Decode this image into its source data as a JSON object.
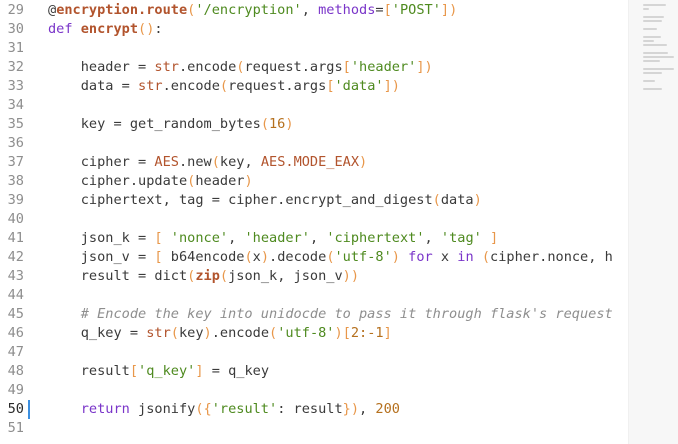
{
  "editor": {
    "current_line": "50",
    "lines": [
      {
        "num": "29",
        "tokens": [
          {
            "t": "dec-at",
            "v": "@"
          },
          {
            "t": "dec",
            "v": "encryption.route"
          },
          {
            "t": "paren",
            "v": "("
          },
          {
            "t": "str",
            "v": "'/encryption'"
          },
          {
            "t": "plain",
            "v": ", "
          },
          {
            "t": "kw",
            "v": "methods"
          },
          {
            "t": "op",
            "v": "="
          },
          {
            "t": "brack",
            "v": "["
          },
          {
            "t": "str",
            "v": "'POST'"
          },
          {
            "t": "brack",
            "v": "]"
          },
          {
            "t": "paren",
            "v": ")"
          }
        ]
      },
      {
        "num": "30",
        "tokens": [
          {
            "t": "kw",
            "v": "def "
          },
          {
            "t": "fn",
            "v": "encrypt"
          },
          {
            "t": "paren",
            "v": "()"
          },
          {
            "t": "plain",
            "v": ":"
          }
        ]
      },
      {
        "num": "31",
        "tokens": []
      },
      {
        "num": "32",
        "tokens": [
          {
            "t": "plain",
            "v": "    header "
          },
          {
            "t": "op",
            "v": "= "
          },
          {
            "t": "bi",
            "v": "str"
          },
          {
            "t": "plain",
            "v": ".encode"
          },
          {
            "t": "paren",
            "v": "("
          },
          {
            "t": "plain",
            "v": "request.args"
          },
          {
            "t": "brack",
            "v": "["
          },
          {
            "t": "str",
            "v": "'header'"
          },
          {
            "t": "brack",
            "v": "]"
          },
          {
            "t": "paren",
            "v": ")"
          }
        ]
      },
      {
        "num": "33",
        "tokens": [
          {
            "t": "plain",
            "v": "    data "
          },
          {
            "t": "op",
            "v": "= "
          },
          {
            "t": "bi",
            "v": "str"
          },
          {
            "t": "plain",
            "v": ".encode"
          },
          {
            "t": "paren",
            "v": "("
          },
          {
            "t": "plain",
            "v": "request.args"
          },
          {
            "t": "brack",
            "v": "["
          },
          {
            "t": "str",
            "v": "'data'"
          },
          {
            "t": "brack",
            "v": "]"
          },
          {
            "t": "paren",
            "v": ")"
          }
        ]
      },
      {
        "num": "34",
        "tokens": []
      },
      {
        "num": "35",
        "tokens": [
          {
            "t": "plain",
            "v": "    key "
          },
          {
            "t": "op",
            "v": "= "
          },
          {
            "t": "plain",
            "v": "get_random_bytes"
          },
          {
            "t": "paren",
            "v": "("
          },
          {
            "t": "num",
            "v": "16"
          },
          {
            "t": "paren",
            "v": ")"
          }
        ]
      },
      {
        "num": "36",
        "tokens": []
      },
      {
        "num": "37",
        "tokens": [
          {
            "t": "plain",
            "v": "    cipher "
          },
          {
            "t": "op",
            "v": "= "
          },
          {
            "t": "bi",
            "v": "AES"
          },
          {
            "t": "plain",
            "v": ".new"
          },
          {
            "t": "paren",
            "v": "("
          },
          {
            "t": "plain",
            "v": "key, "
          },
          {
            "t": "bi",
            "v": "AES.MODE_EAX"
          },
          {
            "t": "paren",
            "v": ")"
          }
        ]
      },
      {
        "num": "38",
        "tokens": [
          {
            "t": "plain",
            "v": "    cipher.update"
          },
          {
            "t": "paren",
            "v": "("
          },
          {
            "t": "plain",
            "v": "header"
          },
          {
            "t": "paren",
            "v": ")"
          }
        ]
      },
      {
        "num": "39",
        "tokens": [
          {
            "t": "plain",
            "v": "    ciphertext, tag "
          },
          {
            "t": "op",
            "v": "= "
          },
          {
            "t": "plain",
            "v": "cipher.encrypt_and_digest"
          },
          {
            "t": "paren",
            "v": "("
          },
          {
            "t": "plain",
            "v": "data"
          },
          {
            "t": "paren",
            "v": ")"
          }
        ]
      },
      {
        "num": "40",
        "tokens": []
      },
      {
        "num": "41",
        "tokens": [
          {
            "t": "plain",
            "v": "    json_k "
          },
          {
            "t": "op",
            "v": "= "
          },
          {
            "t": "brack",
            "v": "[ "
          },
          {
            "t": "str",
            "v": "'nonce'"
          },
          {
            "t": "plain",
            "v": ", "
          },
          {
            "t": "str",
            "v": "'header'"
          },
          {
            "t": "plain",
            "v": ", "
          },
          {
            "t": "str",
            "v": "'ciphertext'"
          },
          {
            "t": "plain",
            "v": ", "
          },
          {
            "t": "str",
            "v": "'tag'"
          },
          {
            "t": "brack",
            "v": " ]"
          }
        ]
      },
      {
        "num": "42",
        "tokens": [
          {
            "t": "plain",
            "v": "    json_v "
          },
          {
            "t": "op",
            "v": "= "
          },
          {
            "t": "brack",
            "v": "[ "
          },
          {
            "t": "plain",
            "v": "b64encode"
          },
          {
            "t": "paren",
            "v": "("
          },
          {
            "t": "plain",
            "v": "x"
          },
          {
            "t": "paren",
            "v": ")"
          },
          {
            "t": "plain",
            "v": ".decode"
          },
          {
            "t": "paren",
            "v": "("
          },
          {
            "t": "str",
            "v": "'utf-8'"
          },
          {
            "t": "paren",
            "v": ")"
          },
          {
            "t": "kw",
            "v": " for "
          },
          {
            "t": "plain",
            "v": "x "
          },
          {
            "t": "kw",
            "v": "in "
          },
          {
            "t": "paren",
            "v": "("
          },
          {
            "t": "plain",
            "v": "cipher.nonce, h"
          }
        ]
      },
      {
        "num": "43",
        "tokens": [
          {
            "t": "plain",
            "v": "    result "
          },
          {
            "t": "op",
            "v": "= "
          },
          {
            "t": "plain",
            "v": "dict"
          },
          {
            "t": "paren",
            "v": "("
          },
          {
            "t": "boldfn",
            "v": "zip"
          },
          {
            "t": "paren",
            "v": "("
          },
          {
            "t": "plain",
            "v": "json_k, json_v"
          },
          {
            "t": "paren",
            "v": "))"
          }
        ]
      },
      {
        "num": "44",
        "tokens": []
      },
      {
        "num": "45",
        "tokens": [
          {
            "t": "cm",
            "v": "    # Encode the key into unidocde to pass it through flask's request"
          }
        ]
      },
      {
        "num": "46",
        "tokens": [
          {
            "t": "plain",
            "v": "    q_key "
          },
          {
            "t": "op",
            "v": "= "
          },
          {
            "t": "bi",
            "v": "str"
          },
          {
            "t": "paren",
            "v": "("
          },
          {
            "t": "plain",
            "v": "key"
          },
          {
            "t": "paren",
            "v": ")"
          },
          {
            "t": "plain",
            "v": ".encode"
          },
          {
            "t": "paren",
            "v": "("
          },
          {
            "t": "str",
            "v": "'utf-8'"
          },
          {
            "t": "paren",
            "v": ")"
          },
          {
            "t": "brack",
            "v": "["
          },
          {
            "t": "num",
            "v": "2:-1"
          },
          {
            "t": "brack",
            "v": "]"
          }
        ]
      },
      {
        "num": "47",
        "tokens": []
      },
      {
        "num": "48",
        "tokens": [
          {
            "t": "plain",
            "v": "    result"
          },
          {
            "t": "brack",
            "v": "["
          },
          {
            "t": "str",
            "v": "'q_key'"
          },
          {
            "t": "brack",
            "v": "]"
          },
          {
            "t": "op",
            "v": " = "
          },
          {
            "t": "plain",
            "v": "q_key"
          }
        ]
      },
      {
        "num": "49",
        "tokens": []
      },
      {
        "num": "50",
        "tokens": [
          {
            "t": "kw",
            "v": "    return "
          },
          {
            "t": "plain",
            "v": "jsonify"
          },
          {
            "t": "paren",
            "v": "("
          },
          {
            "t": "brack",
            "v": "{"
          },
          {
            "t": "str",
            "v": "'result'"
          },
          {
            "t": "plain",
            "v": ": result"
          },
          {
            "t": "brack",
            "v": "}"
          },
          {
            "t": "paren",
            "v": ")"
          },
          {
            "t": "plain",
            "v": ", "
          },
          {
            "t": "num",
            "v": "200"
          }
        ]
      },
      {
        "num": "51",
        "tokens": []
      }
    ]
  }
}
